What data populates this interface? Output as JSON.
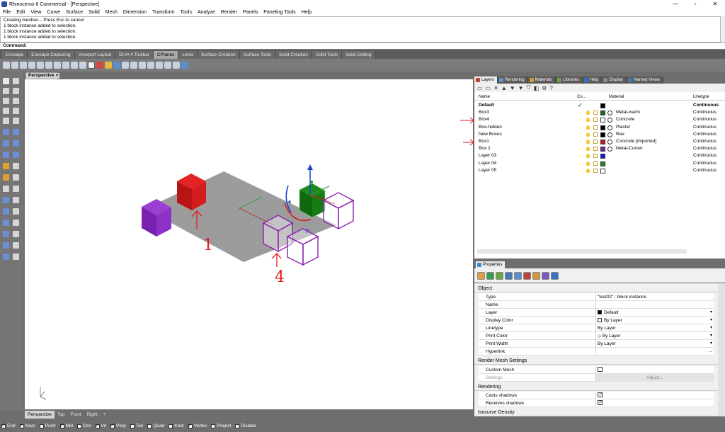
{
  "window": {
    "title": "Rhinoceros 6 Commercial - [Perspective]",
    "controls": [
      "—",
      "▫",
      "✕"
    ]
  },
  "menu": [
    "File",
    "Edit",
    "View",
    "Curve",
    "Surface",
    "Solid",
    "Mesh",
    "Dimension",
    "Transform",
    "Tools",
    "Analyze",
    "Render",
    "Panels",
    "Paneling Tools",
    "Help"
  ],
  "command_history": [
    "Creating meshes... Press Esc to cancel",
    "1 block instance added to selection.",
    "1 block instance added to selection.",
    "1 block instance added to selection."
  ],
  "command_prompt": "Command:",
  "toolbar_tabs": [
    "Enscape",
    "Enscape Capturing",
    "Viewport Layout",
    "DIVA 4 Toolbar",
    "CPlanes",
    "Lines",
    "Surface Creation",
    "Surface Tools",
    "Solid Creation",
    "Solid Tools",
    "Solid Editing"
  ],
  "toolbar_active_tab": "CPlanes",
  "viewport": {
    "title": "Perspective",
    "tabs": [
      "Perspective",
      "Top",
      "Front",
      "Right",
      "+"
    ],
    "annotations": [
      "1",
      "4"
    ]
  },
  "statusbar": [
    {
      "label": "End",
      "on": true
    },
    {
      "label": "Near",
      "on": true
    },
    {
      "label": "Point",
      "on": false
    },
    {
      "label": "Mid",
      "on": true
    },
    {
      "label": "Cen",
      "on": false
    },
    {
      "label": "Int",
      "on": true
    },
    {
      "label": "Perp",
      "on": true
    },
    {
      "label": "Tan",
      "on": false
    },
    {
      "label": "Quad",
      "on": false
    },
    {
      "label": "Knot",
      "on": false
    },
    {
      "label": "Vertex",
      "on": true
    },
    {
      "label": "Project",
      "on": false
    },
    {
      "label": "Disable",
      "on": false
    }
  ],
  "panel_tabs": [
    {
      "label": "Layers",
      "color": "#c2403a",
      "active": true
    },
    {
      "label": "Rendering",
      "color": "#5b8fcf",
      "active": false
    },
    {
      "label": "Materials",
      "color": "#d49a3a",
      "active": false
    },
    {
      "label": "Libraries",
      "color": "#6aa34a",
      "active": false
    },
    {
      "label": "Help",
      "color": "#3b6fc7",
      "active": false
    },
    {
      "label": "Display",
      "color": "#888888",
      "active": false
    },
    {
      "label": "Named Views",
      "color": "#4a7ab5",
      "active": false
    }
  ],
  "layers": {
    "headers": {
      "name": "Name",
      "current": "Cu...",
      "material": "Material",
      "linetype": "Linetype"
    },
    "rows": [
      {
        "name": "Default",
        "bold": true,
        "current": true,
        "color": "#000000",
        "material": "",
        "has_mat": false,
        "linetype": "Continuous"
      },
      {
        "name": "Box3",
        "bold": false,
        "current": false,
        "color": "#1a6b1a",
        "material": "Metal-warm",
        "has_mat": true,
        "linetype": "Continuous"
      },
      {
        "name": "Box4",
        "bold": false,
        "current": false,
        "color": "#ffffff",
        "material": "Concrete",
        "has_mat": true,
        "linetype": "Continuous"
      },
      {
        "name": "Box-hidden",
        "bold": false,
        "current": false,
        "color": "#000000",
        "material": "Plaster",
        "has_mat": true,
        "linetype": "Continuous"
      },
      {
        "name": "New Boxes",
        "bold": false,
        "current": false,
        "color": "#000000",
        "material": "Ree",
        "has_mat": true,
        "linetype": "Continuous"
      },
      {
        "name": "Box1",
        "bold": false,
        "current": false,
        "color": "#d01818",
        "material": "Concrete [imported]",
        "has_mat": true,
        "linetype": "Continuous"
      },
      {
        "name": "Box 2",
        "bold": false,
        "current": false,
        "color": "#7a1fa2",
        "material": "Metal-Corten",
        "has_mat": true,
        "linetype": "Continuous"
      },
      {
        "name": "Layer 03",
        "bold": false,
        "current": false,
        "color": "#1a1ad0",
        "material": "",
        "has_mat": false,
        "linetype": "Continuous"
      },
      {
        "name": "Layer 04",
        "bold": false,
        "current": false,
        "color": "#1a8a1a",
        "material": "",
        "has_mat": false,
        "linetype": "Continuous"
      },
      {
        "name": "Layer 05",
        "bold": false,
        "current": false,
        "color": "#ffffff",
        "material": "",
        "has_mat": false,
        "linetype": "Continuous"
      }
    ]
  },
  "properties": {
    "tab": "Properties",
    "sections": {
      "object": "Object",
      "render_mesh": "Render Mesh Settings",
      "rendering": "Rendering",
      "isocurve": "Isocurve Density"
    },
    "object_rows": [
      {
        "key": "Type",
        "value": "\"test02\" : block instance"
      },
      {
        "key": "Name",
        "value": ""
      },
      {
        "key": "Layer",
        "value": "Default"
      },
      {
        "key": "Display Color",
        "value": "By Layer"
      },
      {
        "key": "Linetype",
        "value": "By Layer"
      },
      {
        "key": "Print Color",
        "value": "By Layer"
      },
      {
        "key": "Print Width",
        "value": "By Layer"
      },
      {
        "key": "Hyperlink",
        "value": "..."
      }
    ],
    "mesh_rows": [
      {
        "key": "Custom Mesh",
        "checked": false
      },
      {
        "key": "Settings",
        "button": "Adjust..."
      }
    ],
    "render_rows": [
      {
        "key": "Casts shadows",
        "checked": true
      },
      {
        "key": "Receives shadows",
        "checked": true
      }
    ]
  },
  "colors": {
    "accent_red": "#e21b1b",
    "viewport_bg": "#ffffff",
    "app_gray": "#6e6e6e"
  }
}
